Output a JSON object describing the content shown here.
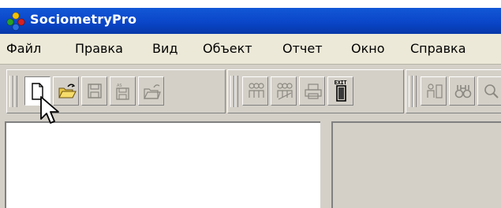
{
  "window": {
    "title": "SociometryPro"
  },
  "menu": {
    "items": [
      {
        "label": "Файл"
      },
      {
        "label": "Правка"
      },
      {
        "label": "Вид"
      },
      {
        "label": "Объект"
      },
      {
        "label": "Отчет"
      },
      {
        "label": "Окно"
      },
      {
        "label": "Справка"
      }
    ]
  },
  "toolbar": {
    "exit_label": "EXIT",
    "buttons": [
      {
        "icon": "new-document-icon",
        "state": "pressed"
      },
      {
        "icon": "open-folder-icon",
        "state": "enabled"
      },
      {
        "icon": "save-icon",
        "state": "disabled"
      },
      {
        "icon": "save-as-icon",
        "state": "disabled"
      },
      {
        "icon": "close-folder-icon",
        "state": "disabled"
      },
      {
        "icon": "group-icon",
        "state": "disabled"
      },
      {
        "icon": "group-edit-icon",
        "state": "disabled"
      },
      {
        "icon": "print-icon",
        "state": "disabled"
      },
      {
        "icon": "exit-icon",
        "state": "enabled"
      },
      {
        "icon": "people-icon",
        "state": "disabled"
      },
      {
        "icon": "find-icon",
        "state": "disabled"
      },
      {
        "icon": "find-next-icon",
        "state": "disabled"
      }
    ]
  },
  "colors": {
    "titlebar": "#0a46c9",
    "menubar": "#ece9d8",
    "face": "#d4d0c8",
    "disabled_icon": "#8a8880"
  }
}
